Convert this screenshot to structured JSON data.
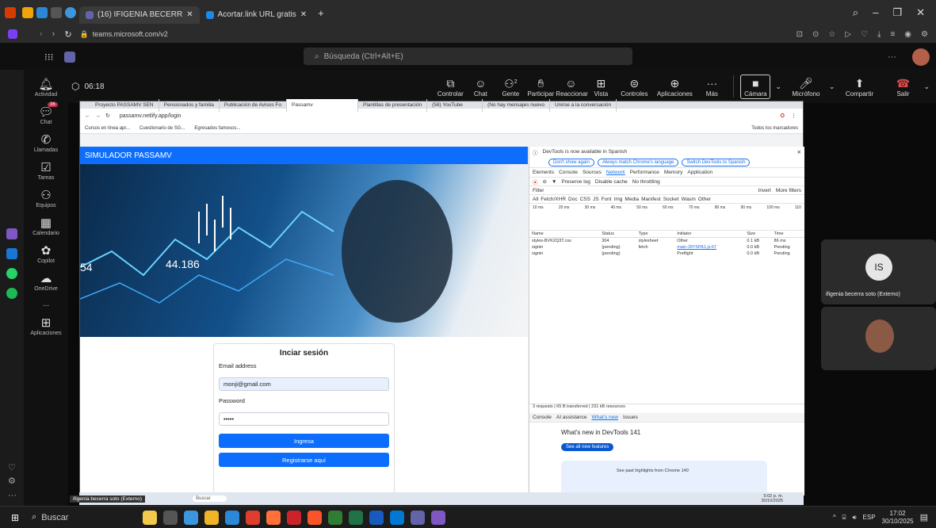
{
  "browser": {
    "tabs": [
      "(16) IFIGENIA BECERR",
      "Acortar.link URL gratis"
    ],
    "url": "teams.microsoft.com/v2"
  },
  "teams": {
    "search_placeholder": "Búsqueda (Ctrl+Alt+E)",
    "rail": [
      "Actividad",
      "Chat",
      "Llamadas",
      "Tareas",
      "Equipos",
      "Calendario",
      "Copilot",
      "OneDrive",
      "...",
      "Aplicaciones"
    ],
    "chat_badge": "36",
    "timer": "06:18",
    "controls": [
      "Controlar",
      "Chat",
      "Gente",
      "Participar",
      "Reaccionar",
      "Vista",
      "Controles",
      "Aplicaciones",
      "Más"
    ],
    "people_count": "2",
    "camera": "Cámara",
    "mic": "Micrófono",
    "share": "Compartir",
    "leave": "Salir",
    "participant_initials": "IS",
    "participant_name": "ifigenia becerra soto (Externo)"
  },
  "shared": {
    "tabs": [
      "Proyecto PASSAMV SEN",
      "Pensionados y familia",
      "Publicación de Avisos Fo",
      "Passamv",
      "Plantillas de presentación",
      "(58) YouTube",
      "(No hay mensajes nuevo",
      "Unirse a la conversación"
    ],
    "url": "passamv.netlify.app/login",
    "bookmarks": [
      "Cursos en línea apr...",
      "Cuestionario de SG...",
      "Egresados famosos..."
    ],
    "all_bookmarks": "Todos los marcadores",
    "site_title": "SIMULADOR PASSAMV",
    "hero_number": "44.186",
    "hero_left": "54",
    "login": {
      "title": "Inciar sesión",
      "email_label": "Email address",
      "email_value": "monji@gmail.com",
      "password_label": "Password",
      "password_value": "•••••",
      "submit": "Ingresa",
      "register": "Registrarse aquí"
    },
    "devtools": {
      "notice": "DevTools is now available in Spanish",
      "btn1": "Don't show again",
      "btn2": "Always match Chrome's language",
      "btn3": "Switch DevTools to Spanish",
      "tabs": [
        "Elements",
        "Console",
        "Sources",
        "Network",
        "Performance",
        "Memory",
        "Application"
      ],
      "preserve": "Preserve log",
      "disable_cache": "Disable cache",
      "throttle": "No throttling",
      "filter": "Filter",
      "invert": "Invert",
      "more_filters": "More filters",
      "types": [
        "All",
        "Fetch/XHR",
        "Doc",
        "CSS",
        "JS",
        "Font",
        "Img",
        "Media",
        "Manifest",
        "Socket",
        "Wasm",
        "Other"
      ],
      "timeline": [
        "10 ms",
        "20 ms",
        "30 ms",
        "40 ms",
        "50 ms",
        "60 ms",
        "70 ms",
        "80 ms",
        "90 ms",
        "100 ms",
        "110"
      ],
      "headers": [
        "Name",
        "Status",
        "Type",
        "Initiator",
        "Size",
        "Time"
      ],
      "rows": [
        [
          "styles-BVK2Q3T.css",
          "304",
          "stylesheet",
          "Other",
          "0.1 kB",
          "86 ms"
        ],
        [
          "signin",
          "(pending)",
          "fetch",
          "main-28Y5PA1.js:67",
          "0.0 kB",
          "Pending"
        ],
        [
          "signin",
          "(pending)",
          "",
          "Preflight",
          "0.0 kB",
          "Pending"
        ]
      ],
      "summary": "3 requests | 65 B transferred | 231 kB resources",
      "drawer_tabs": [
        "Console",
        "AI assistance",
        "What's new",
        "Issues"
      ],
      "whatsnew": "What's new in DevTools 141",
      "see_all": "See all new features",
      "highlights": "See past highlights from Chrome 140"
    }
  },
  "share_taskbar": {
    "name": "ifigenia becerra soto (Externo)",
    "search": "Buscar",
    "time": "5:02 p. m.",
    "date": "30/10/2025"
  },
  "taskbar": {
    "search": "Buscar",
    "lang": "ESP",
    "time": "17:02",
    "date": "30/10/2025"
  }
}
